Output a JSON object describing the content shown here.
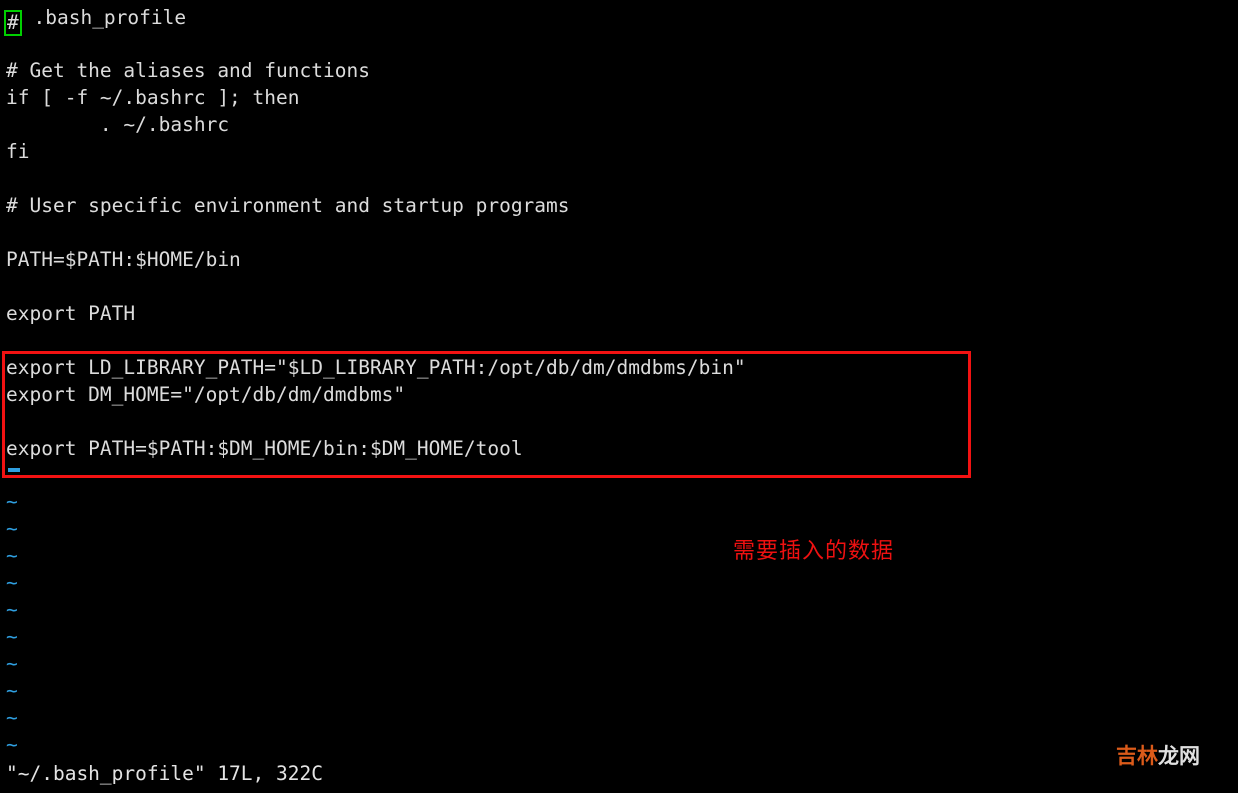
{
  "app": {
    "name": "vim",
    "terminal_bg": "#000000",
    "text_color": "#dcdcdc",
    "tilde_color": "#2f9fe0",
    "cursor_color": "#00d000",
    "highlight_color": "#f21212"
  },
  "header": {
    "cursor_char": "#",
    "title": " .bash_profile"
  },
  "editor": {
    "lines": [
      {
        "index": 1,
        "text": "# Get the aliases and functions"
      },
      {
        "index": 2,
        "text": "if [ -f ~/.bashrc ]; then"
      },
      {
        "index": 3,
        "text": "        . ~/.bashrc"
      },
      {
        "index": 4,
        "text": "fi"
      },
      {
        "index": 5,
        "text": ""
      },
      {
        "index": 6,
        "text": "# User specific environment and startup programs"
      },
      {
        "index": 7,
        "text": ""
      },
      {
        "index": 8,
        "text": "PATH=$PATH:$HOME/bin"
      },
      {
        "index": 9,
        "text": ""
      },
      {
        "index": 10,
        "text": "export PATH"
      },
      {
        "index": 11,
        "text": ""
      },
      {
        "index": 12,
        "text": "export LD_LIBRARY_PATH=\"$LD_LIBRARY_PATH:/opt/db/dm/dmdbms/bin\""
      },
      {
        "index": 13,
        "text": "export DM_HOME=\"/opt/db/dm/dmdbms\""
      },
      {
        "index": 14,
        "text": ""
      },
      {
        "index": 15,
        "text": "export PATH=$PATH:$DM_HOME/bin:$DM_HOME/tool"
      },
      {
        "index": 16,
        "text": ""
      }
    ],
    "filler_marker": "~",
    "filler_count": 10
  },
  "highlight": {
    "label": "needs-insert-block",
    "color": "#f21212",
    "covers_lines": [
      12,
      13,
      14,
      15
    ]
  },
  "annotation": {
    "text": "需要插入的数据",
    "color": "#ee1111"
  },
  "status": {
    "text": "\"~/.bash_profile\" 17L, 322C",
    "filename": "~/.bash_profile",
    "line_count": "17L",
    "byte_count": "322C"
  },
  "watermark": {
    "part_a": "吉林",
    "part_b": "龙网",
    "color_a": "#e8601c",
    "color_b": "#ececec"
  }
}
